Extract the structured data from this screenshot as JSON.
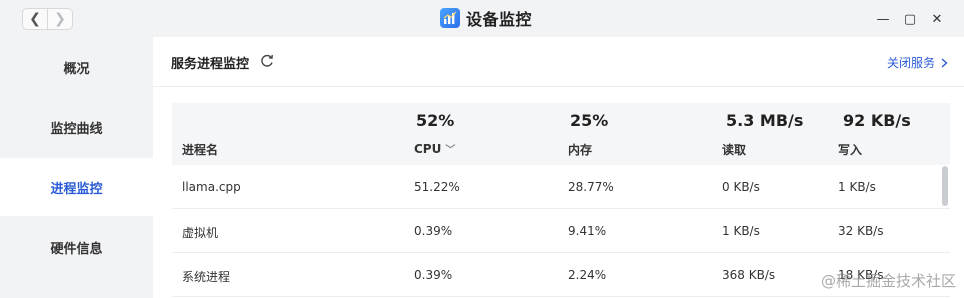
{
  "window": {
    "title": "设备监控",
    "nav": {
      "back": "❮",
      "forward": "❯"
    },
    "controls": {
      "minimize": "—",
      "maximize": "▢",
      "close": "✕"
    }
  },
  "sidebar": {
    "items": [
      {
        "label": "概况"
      },
      {
        "label": "监控曲线"
      },
      {
        "label": "进程监控",
        "active": true
      },
      {
        "label": "硬件信息"
      }
    ]
  },
  "main": {
    "section_title": "服务进程监控",
    "stop_service": "关闭服务",
    "summary": {
      "cpu": "52%",
      "memory": "25%",
      "read": "5.3 MB/s",
      "write": "92 KB/s"
    },
    "columns": {
      "name": "进程名",
      "cpu": "CPU",
      "memory": "内存",
      "read": "读取",
      "write": "写入"
    },
    "rows": [
      {
        "name": "llama.cpp",
        "cpu": "51.22%",
        "memory": "28.77%",
        "read": "0 KB/s",
        "write": "1 KB/s"
      },
      {
        "name": "虚拟机",
        "cpu": "0.39%",
        "memory": "9.41%",
        "read": "1 KB/s",
        "write": "32 KB/s"
      },
      {
        "name": "系统进程",
        "cpu": "0.39%",
        "memory": "2.24%",
        "read": "368 KB/s",
        "write": "18 KB/s"
      }
    ]
  },
  "watermark": "@稀土掘金技术社区",
  "colors": {
    "accent": "#2a5bd7",
    "sidebar_bg": "#f2f3f5",
    "header_bg": "#f5f6f8"
  }
}
